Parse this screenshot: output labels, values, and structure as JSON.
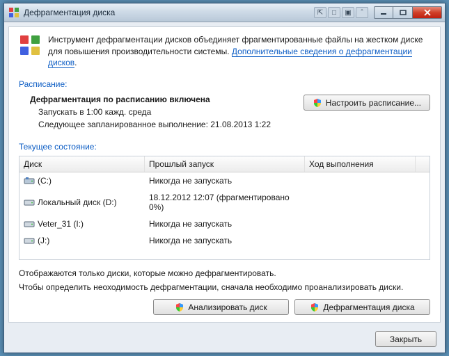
{
  "titlebar": {
    "title": "Дефрагментация диска"
  },
  "intro": {
    "text_before": "Инструмент дефрагментации дисков объединяет фрагментированные файлы на жестком диске для повышения производительности системы. ",
    "link": "Дополнительные сведения о дефрагментации дисков",
    "text_after": "."
  },
  "schedule": {
    "label": "Расписание:",
    "status": "Дефрагментация по расписанию включена",
    "run_at": "Запускать в 1:00 кажд. среда",
    "next_run": "Следующее запланированное выполнение: 21.08.2013 1:22",
    "configure_button": "Настроить расписание..."
  },
  "state": {
    "label": "Текущее состояние:",
    "columns": {
      "disk": "Диск",
      "last": "Прошлый запуск",
      "progress": "Ход выполнения"
    },
    "rows": [
      {
        "name": "(C:)",
        "last": "Никогда не запускать",
        "progress": "",
        "icon": "sys"
      },
      {
        "name": "Локальный диск (D:)",
        "last": "18.12.2012 12:07 (фрагментировано 0%)",
        "progress": "",
        "icon": "hdd"
      },
      {
        "name": "Veter_31 (I:)",
        "last": "Никогда не запускать",
        "progress": "",
        "icon": "hdd"
      },
      {
        "name": "(J:)",
        "last": "Никогда не запускать",
        "progress": "",
        "icon": "hdd"
      }
    ]
  },
  "notes": {
    "line1": "Отображаются только диски, которые можно дефрагментировать.",
    "line2": "Чтобы определить неоходимость  дефрагментации, сначала необходимо проанализировать диски."
  },
  "buttons": {
    "analyze": "Анализировать диск",
    "defrag": "Дефрагментация диска",
    "close": "Закрыть"
  }
}
